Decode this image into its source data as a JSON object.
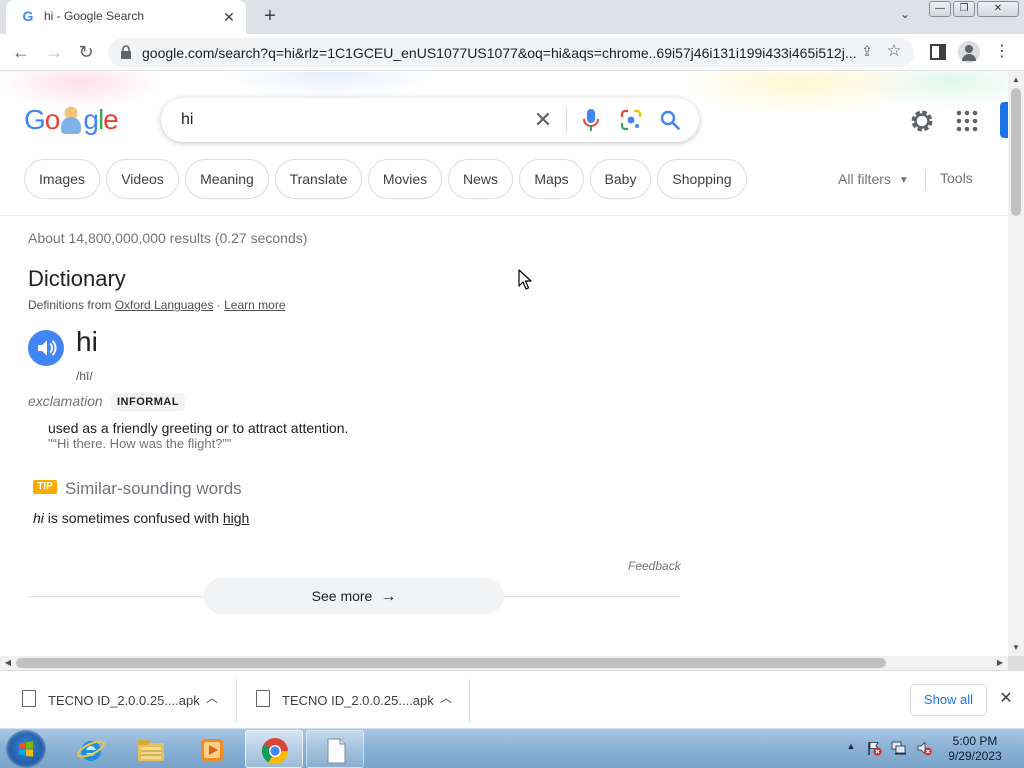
{
  "browser": {
    "tab_favicon": "G",
    "tab_title": "hi - Google Search",
    "tab_close": "✕",
    "new_tab": "+",
    "tab_search": "⌄",
    "win_minimize": "—",
    "win_restore": "❐",
    "win_close": "✕",
    "back": "←",
    "forward": "→",
    "reload": "↻",
    "url": "google.com/search?q=hi&rlz=1C1GCEU_enUS1077US1077&oq=hi&aqs=chrome..69i57j46i131i199i433i465i512j...",
    "share": "⇪",
    "bookmark": "☆",
    "menu": "⋮"
  },
  "search": {
    "logo": [
      "G",
      "o",
      "g",
      "l",
      "e"
    ],
    "query": "hi",
    "clear": "✕"
  },
  "chips": [
    {
      "label": "Images"
    },
    {
      "label": "Videos"
    },
    {
      "label": "Meaning"
    },
    {
      "label": "Translate"
    },
    {
      "label": "Movies"
    },
    {
      "label": "News"
    },
    {
      "label": "Maps"
    },
    {
      "label": "Baby"
    },
    {
      "label": "Shopping"
    }
  ],
  "filters": {
    "all_filters": "All filters",
    "caret": "▼",
    "tools": "Tools"
  },
  "results": {
    "stats": "About 14,800,000,000 results (0.27 seconds)"
  },
  "dictionary": {
    "title": "Dictionary",
    "from_prefix": "Definitions from ",
    "source": "Oxford Languages",
    "separator": " · ",
    "learn_more": "Learn more",
    "word": "hi",
    "pronunciation": "/hī/",
    "part_of_speech": "exclamation",
    "register": "INFORMAL",
    "definition": "used as a friendly greeting or to attract attention.",
    "example": "\"“Hi there. How was the flight?”\"",
    "tip_badge": "TIP",
    "tip_title": "Similar-sounding words",
    "tip_word": "hi",
    "tip_text": " is sometimes confused with ",
    "tip_link": "high",
    "feedback": "Feedback",
    "see_more": "See more",
    "see_more_arrow": "→"
  },
  "scroll": {
    "up": "▲",
    "down": "▼",
    "left": "◀",
    "right": "▶"
  },
  "downloads": {
    "items": [
      {
        "name": "TECNO ID_2.0.0.25....apk",
        "chevron": "︿"
      },
      {
        "name": "TECNO ID_2.0.0.25....apk",
        "chevron": "︿"
      }
    ],
    "show_all": "Show all",
    "close": "✕"
  },
  "taskbar": {
    "tray_expand": "▲",
    "time": "5:00 PM",
    "date": "9/29/2023"
  },
  "colors": {
    "google_blue": "#4285f4",
    "google_red": "#ea4335",
    "google_yellow": "#fbbc05",
    "google_green": "#34a853",
    "tip_orange": "#f9ab00"
  }
}
